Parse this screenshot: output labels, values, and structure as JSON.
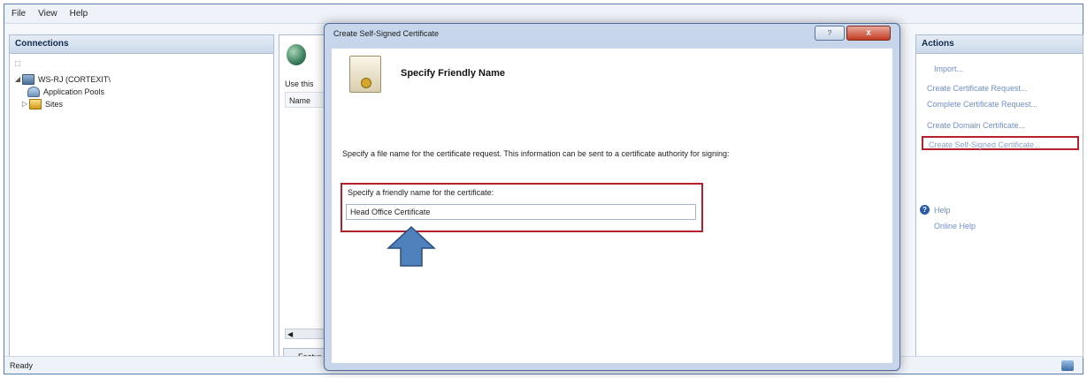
{
  "menu": [
    "File",
    "View",
    "Help"
  ],
  "connections": {
    "header": "Connections",
    "tree": [
      {
        "label": "WS-RJ (CORTEXIT\\",
        "toggle": "◢",
        "icon": "server-icon"
      },
      {
        "label": "Application Pools",
        "icon": "app-pool-icon"
      },
      {
        "label": "Sites",
        "toggle": "▷",
        "icon": "sites-icon"
      }
    ]
  },
  "center": {
    "use_text": "Use this",
    "name_header": "Name",
    "scroll_left": "◀",
    "features_tab": "Featur"
  },
  "actions": {
    "header": "Actions",
    "items": [
      "Import...",
      "Create Certificate Request...",
      "Complete Certificate Request...",
      "Create Domain Certificate...",
      "Create Self-Signed Certificate...",
      "Help",
      "Online Help"
    ]
  },
  "status": {
    "text": "Ready"
  },
  "dialog": {
    "title": "Create Self-Signed Certificate",
    "help_btn": "?",
    "close_btn": "X",
    "banner_title": "Specify Friendly Name",
    "description": "Specify a file name for the certificate request.  This information can be sent to a certificate authority for signing:",
    "field_label": "Specify a friendly name for the certificate:",
    "field_value": "Head Office Certificate"
  },
  "colors": {
    "highlight": "#b4202c",
    "arrow": "#4f81bd",
    "link": "#6f8fc6"
  }
}
